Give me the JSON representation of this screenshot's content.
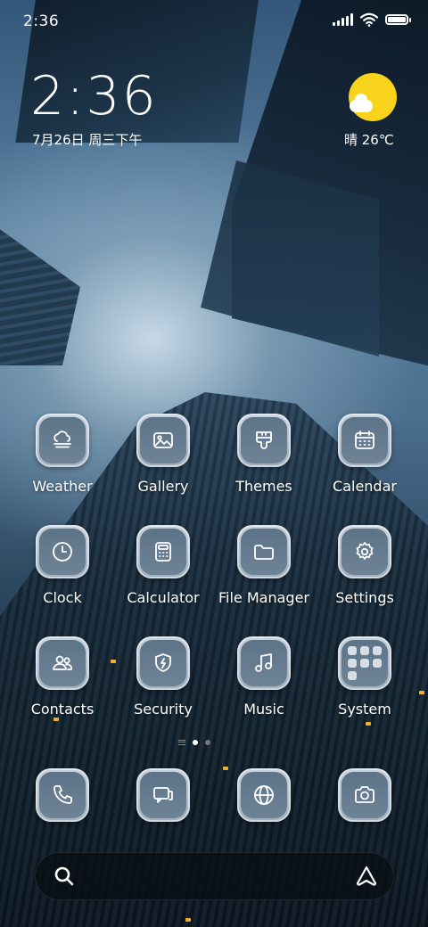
{
  "status_bar": {
    "time": "2:36",
    "icons": [
      "signal-icon",
      "wifi-icon",
      "battery-icon"
    ]
  },
  "clock_widget": {
    "time": "2:36",
    "date": "7月26日 周三下午"
  },
  "weather_widget": {
    "condition_icon": "sun-cloud-icon",
    "text": "晴 26℃",
    "sun_color": "#f7d31c"
  },
  "apps": [
    {
      "label": "Weather",
      "icon": "weather-icon"
    },
    {
      "label": "Gallery",
      "icon": "image-icon"
    },
    {
      "label": "Themes",
      "icon": "brush-icon"
    },
    {
      "label": "Calendar",
      "icon": "calendar-icon"
    },
    {
      "label": "Clock",
      "icon": "clock-icon"
    },
    {
      "label": "Calculator",
      "icon": "calculator-icon"
    },
    {
      "label": "File Manager",
      "icon": "folder-icon"
    },
    {
      "label": "Settings",
      "icon": "gear-icon"
    },
    {
      "label": "Contacts",
      "icon": "contacts-icon"
    },
    {
      "label": "Security",
      "icon": "shield-icon"
    },
    {
      "label": "Music",
      "icon": "music-note-icon"
    },
    {
      "label": "System",
      "icon": "folder-grid-icon"
    }
  ],
  "pager": {
    "pages": 2,
    "active": 1
  },
  "dock": [
    {
      "icon": "phone-icon"
    },
    {
      "icon": "messages-icon"
    },
    {
      "icon": "browser-icon"
    },
    {
      "icon": "camera-icon"
    }
  ],
  "search_bar": {
    "left_icon": "search-icon",
    "right_icon": "assistant-icon"
  },
  "colors": {
    "tile_frame": "#c6d1dc",
    "tile_inner": "#5c7388",
    "label": "#ffffff"
  }
}
